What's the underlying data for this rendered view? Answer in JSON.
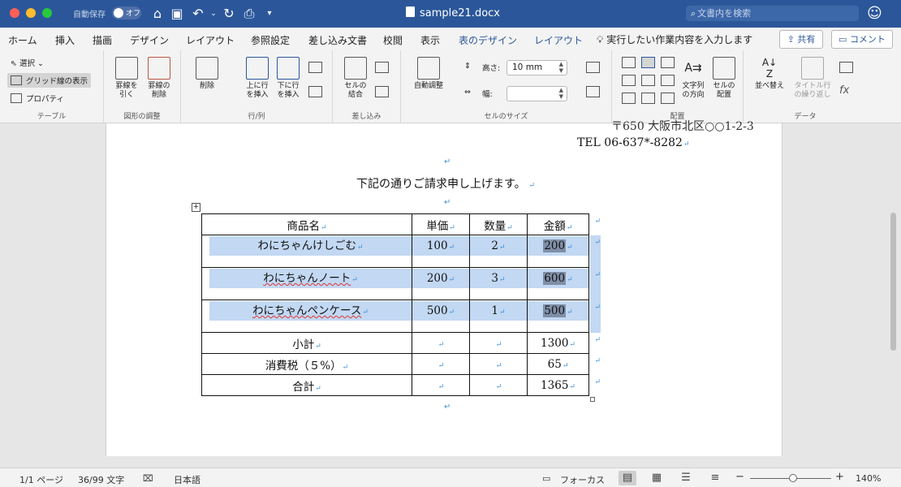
{
  "titlebar": {
    "autosave_label": "自動保存",
    "autosave_state": "オフ",
    "document_title": "sample21.docx",
    "search_placeholder": "文書内を検索"
  },
  "tabs": [
    "ホーム",
    "挿入",
    "描画",
    "デザイン",
    "レイアウト",
    "参照設定",
    "差し込み文書",
    "校閲",
    "表示",
    "表のデザイン",
    "レイアウト"
  ],
  "active_tab": "レイアウト",
  "tell_me": "実行したい作業内容を入力します",
  "share_label": "共有",
  "comment_label": "コメント",
  "ribbon": {
    "table_group": {
      "label": "テーブル",
      "select": "選択",
      "gridlines": "グリッド線の表示",
      "properties": "プロパティ"
    },
    "draw_group": {
      "label": "図形の調整",
      "draw_borders": "罫線を\n引く",
      "erase_borders": "罫線の\n削除"
    },
    "rows_group": {
      "label": "行/列",
      "delete": "削除",
      "insert_above": "上に行\nを挿入",
      "insert_below": "下に行\nを挿入"
    },
    "merge_group": {
      "label": "差し込み",
      "merge_cells": "セルの\n結合"
    },
    "cellsize_group": {
      "label": "セルのサイズ",
      "autofit": "自動調整",
      "height_label": "高さ:",
      "height_value": "10 mm",
      "width_label": "幅:",
      "width_value": ""
    },
    "align_group": {
      "label": "配置",
      "text_direction": "文字列\nの方向",
      "cell_margins": "セルの\n配置"
    },
    "data_group": {
      "label": "データ",
      "sort": "並べ替え",
      "repeat_header": "タイトル行\nの繰り返し"
    }
  },
  "document": {
    "clipped_address": "〒650  大阪市北区○○1-2-3",
    "tel": "TEL   06-637*-8282",
    "lead_text": "下記の通りご請求申し上げます。",
    "table": {
      "headers": [
        "商品名",
        "単価",
        "数量",
        "金額"
      ],
      "items": [
        [
          "わにちゃんけしごむ",
          "100",
          "2",
          "200"
        ],
        [
          "わにちゃんノート",
          "200",
          "3",
          "600"
        ],
        [
          "わにちゃんペンケース",
          "500",
          "1",
          "500"
        ]
      ],
      "totals": [
        [
          "小計",
          "",
          "",
          "1300"
        ],
        [
          "消費税（５%）",
          "",
          "",
          "65"
        ],
        [
          "合計",
          "",
          "",
          "1365"
        ]
      ]
    }
  },
  "statusbar": {
    "page": "1/1 ページ",
    "words": "36/99 文字",
    "language": "日本語",
    "focus": "フォーカス",
    "zoom": "140%"
  }
}
